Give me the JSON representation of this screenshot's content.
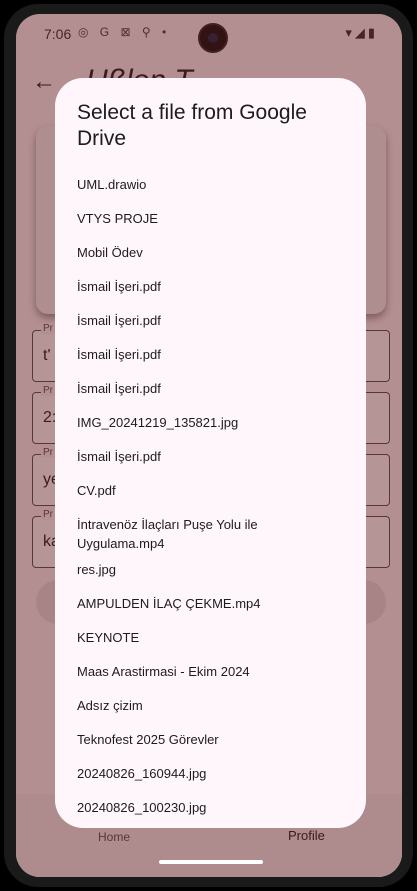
{
  "status": {
    "time": "7:06",
    "left_icons": "◎ G ⊠ ⚲ •",
    "right_icons": "▾◢▮"
  },
  "app": {
    "title": "Ußlen T",
    "fields": [
      {
        "label": "Pr",
        "value": "t'"
      },
      {
        "label": "Pr",
        "value": "2:"
      },
      {
        "label": "Pr",
        "value": "ye"
      },
      {
        "label": "Pr",
        "value": "ka"
      }
    ],
    "nav": {
      "home": "Home",
      "profile": "Profile"
    }
  },
  "dialog": {
    "title": "Select a file from Google Drive",
    "files": [
      "UML.drawio",
      "VTYS PROJE",
      "Mobil Ödev",
      "İsmail İşeri.pdf",
      "İsmail İşeri.pdf",
      "İsmail İşeri.pdf",
      "İsmail İşeri.pdf",
      "IMG_20241219_135821.jpg",
      "İsmail İşeri.pdf",
      "CV.pdf",
      "İntravenöz İlaçları Puşe Yolu ile Uygulama.mp4",
      "res.jpg",
      "AMPULDEN İLAÇ ÇEKME.mp4",
      "KEYNOTE",
      "Maas Arastirmasi - Ekim 2024",
      "Adsız çizim",
      "Teknofest 2025 Görevler",
      "20240826_160944.jpg",
      "20240826_100230.jpg"
    ]
  }
}
